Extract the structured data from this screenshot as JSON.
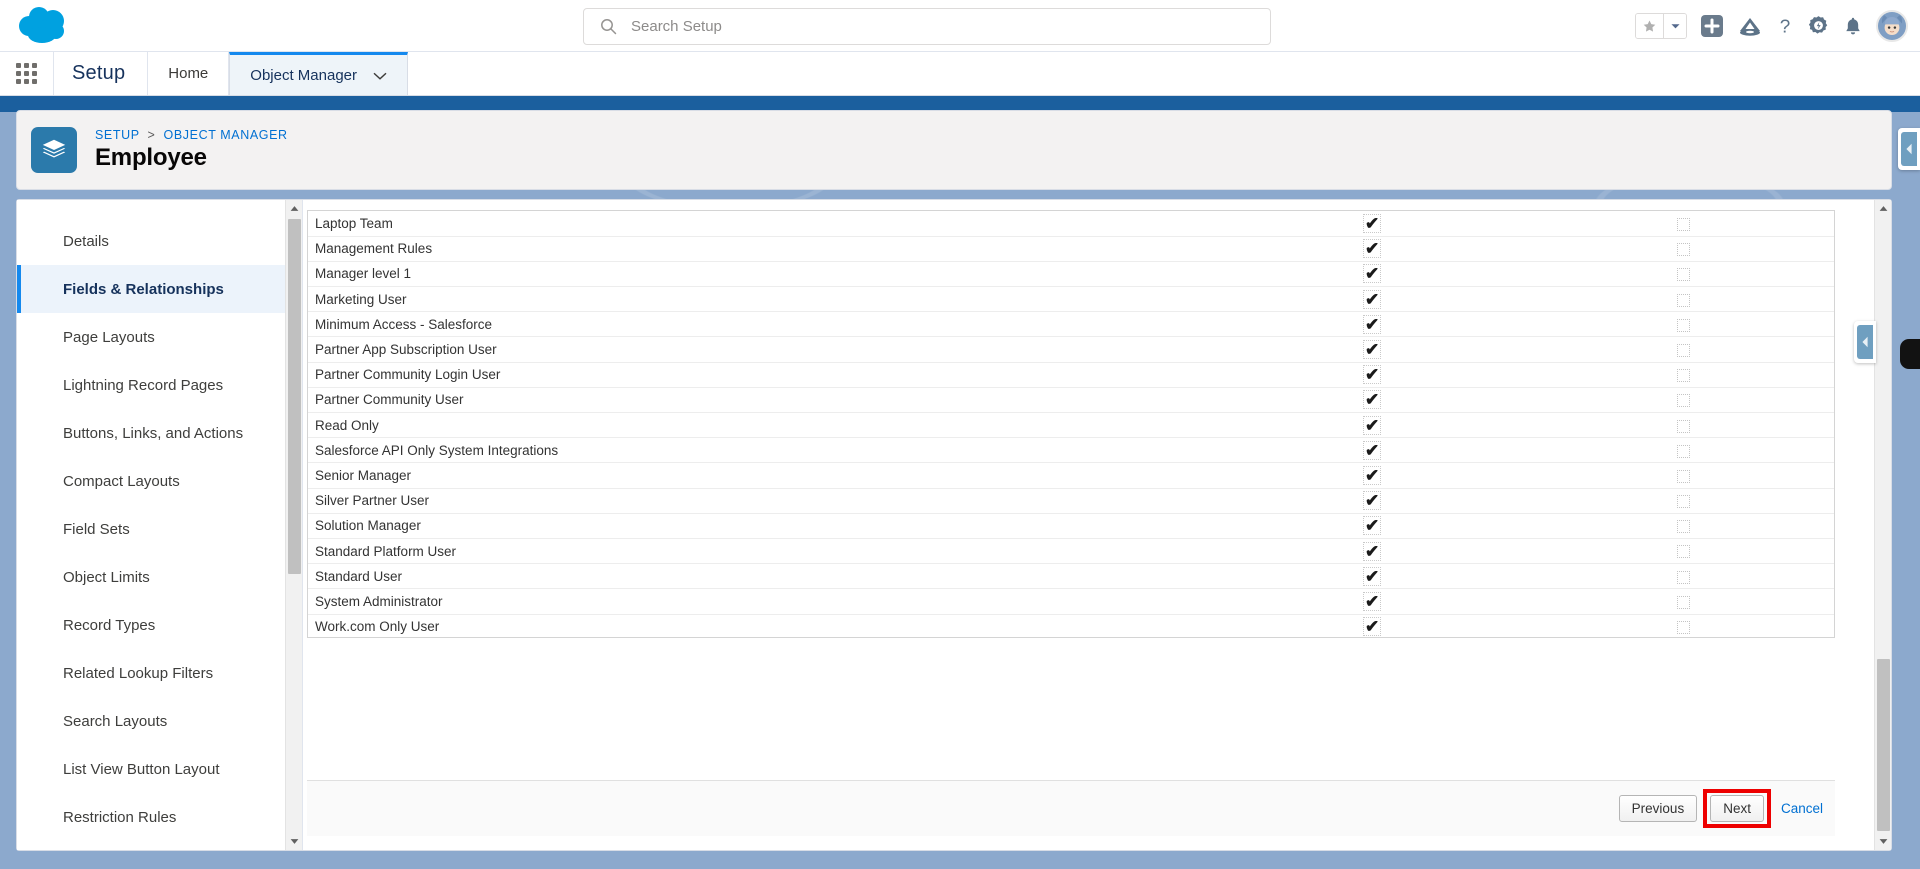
{
  "header": {
    "logo_icon": "salesforce-cloud-logo",
    "search": {
      "placeholder": "Search Setup",
      "value": "",
      "icon": "search-icon"
    },
    "icons": [
      {
        "name": "favorites-star-icon",
        "glyph": "★"
      },
      {
        "name": "favorites-dropdown-caret-icon",
        "glyph": "▼"
      },
      {
        "name": "add-plus-icon",
        "glyph": "+"
      },
      {
        "name": "trailhead-icon",
        "glyph": "trailhead"
      },
      {
        "name": "help-question-icon",
        "glyph": "?"
      },
      {
        "name": "setup-gear-icon",
        "glyph": "gear"
      },
      {
        "name": "notifications-bell-icon",
        "glyph": "bell"
      },
      {
        "name": "user-avatar",
        "glyph": "astro"
      }
    ]
  },
  "setup_nav": {
    "app_launcher_label": "app-launcher",
    "setup_label": "Setup",
    "tabs": [
      {
        "label": "Home",
        "active": false,
        "has_caret": false
      },
      {
        "label": "Object Manager",
        "active": true,
        "has_caret": true
      }
    ],
    "caret_glyph": "⌄"
  },
  "record_header": {
    "icon": "object-stack-icon",
    "breadcrumb": {
      "root": "SETUP",
      "separator": ">",
      "parent": "OBJECT MANAGER"
    },
    "title": "Employee"
  },
  "sidebar": {
    "items": [
      {
        "label": "Details",
        "active": false
      },
      {
        "label": "Fields & Relationships",
        "active": true
      },
      {
        "label": "Page Layouts",
        "active": false
      },
      {
        "label": "Lightning Record Pages",
        "active": false
      },
      {
        "label": "Buttons, Links, and Actions",
        "active": false
      },
      {
        "label": "Compact Layouts",
        "active": false
      },
      {
        "label": "Field Sets",
        "active": false
      },
      {
        "label": "Object Limits",
        "active": false
      },
      {
        "label": "Record Types",
        "active": false
      },
      {
        "label": "Related Lookup Filters",
        "active": false
      },
      {
        "label": "Search Layouts",
        "active": false
      },
      {
        "label": "List View Button Layout",
        "active": false
      },
      {
        "label": "Restriction Rules",
        "active": false
      }
    ],
    "scroll_up_glyph": "▲",
    "scroll_down_glyph": "▼"
  },
  "profile_table": {
    "check_glyph": "✔",
    "rows": [
      {
        "name": "Laptop Team",
        "visible": true,
        "read_only": false
      },
      {
        "name": "Management Rules",
        "visible": true,
        "read_only": false
      },
      {
        "name": "Manager level 1",
        "visible": true,
        "read_only": false
      },
      {
        "name": "Marketing User",
        "visible": true,
        "read_only": false
      },
      {
        "name": "Minimum Access - Salesforce",
        "visible": true,
        "read_only": false
      },
      {
        "name": "Partner App Subscription User",
        "visible": true,
        "read_only": false
      },
      {
        "name": "Partner Community Login User",
        "visible": true,
        "read_only": false
      },
      {
        "name": "Partner Community User",
        "visible": true,
        "read_only": false
      },
      {
        "name": "Read Only",
        "visible": true,
        "read_only": false
      },
      {
        "name": "Salesforce API Only System Integrations",
        "visible": true,
        "read_only": false
      },
      {
        "name": "Senior Manager",
        "visible": true,
        "read_only": false
      },
      {
        "name": "Silver Partner User",
        "visible": true,
        "read_only": false
      },
      {
        "name": "Solution Manager",
        "visible": true,
        "read_only": false
      },
      {
        "name": "Standard Platform User",
        "visible": true,
        "read_only": false
      },
      {
        "name": "Standard User",
        "visible": true,
        "read_only": false
      },
      {
        "name": "System Administrator",
        "visible": true,
        "read_only": false
      },
      {
        "name": "Work.com Only User",
        "visible": true,
        "read_only": false
      }
    ]
  },
  "actions": {
    "previous_label": "Previous",
    "next_label": "Next",
    "cancel_label": "Cancel",
    "highlight_color": "#ee0000",
    "highlighted_button": "Next"
  },
  "edge_tabs": [
    {
      "name": "collapse-panel-tab-top",
      "glyph": "◀"
    },
    {
      "name": "collapse-panel-tab-middle",
      "glyph": "◀"
    }
  ]
}
